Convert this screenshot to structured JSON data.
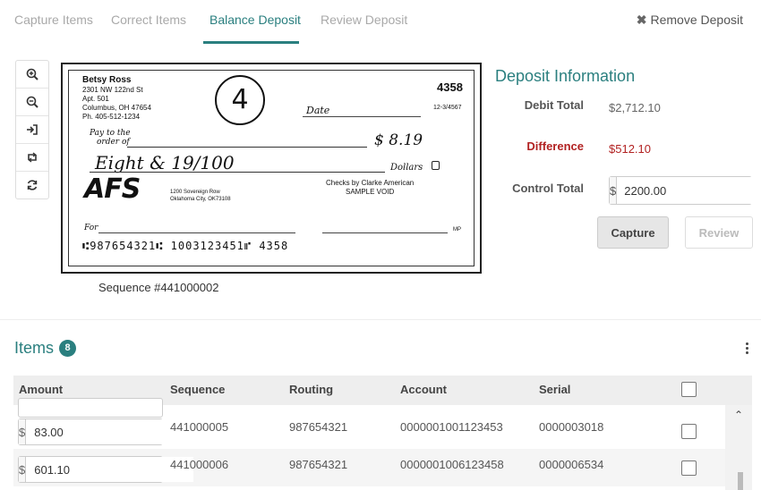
{
  "tabs": [
    {
      "label": "Capture Items"
    },
    {
      "label": "Correct Items"
    },
    {
      "label": "Balance Deposit"
    },
    {
      "label": "Review Deposit"
    }
  ],
  "remove_deposit": "Remove Deposit",
  "tools": [
    "zoom-in-icon",
    "zoom-out-icon",
    "sign-in-icon",
    "retweet-icon",
    "refresh-icon"
  ],
  "check": {
    "name": "Betsy Ross",
    "address1": "2301 NW 122nd St",
    "address2": "Apt. 501",
    "address3": "Columbus, OH 47654",
    "phone": "Ph. 405-512-1234",
    "number": "4358",
    "routing_frac": "12-3/4567",
    "date_label": "Date",
    "pay_to": "Pay to the",
    "order_of": "order of",
    "amount_box": "$ 8.19",
    "written": "Eight & 19/100",
    "dollars": "Dollars",
    "circled": "4",
    "bank1": "Checks by Clarke American",
    "bank2": "SAMPLE VOID",
    "logo": "AFS",
    "bank_addr1": "1200 Sovereign Row",
    "bank_addr2": "Oklahoma City, OK73108",
    "for_label": "For",
    "micr": "⑆987654321⑆  1003123451⑈  4358",
    "mp": "MP"
  },
  "sequence_caption": "Sequence #441000002",
  "deposit": {
    "title": "Deposit Information",
    "debit_label": "Debit Total",
    "debit_value": "$2,712.10",
    "diff_label": "Difference",
    "diff_value": "$512.10",
    "control_label": "Control Total",
    "control_currency": "$",
    "control_value": "2200.00",
    "capture_label": "Capture",
    "review_label": "Review"
  },
  "items": {
    "title": "Items",
    "count": "8",
    "columns": [
      "Amount",
      "Sequence",
      "Routing",
      "Account",
      "Serial"
    ],
    "rows": [
      {
        "currency": "$",
        "amount": "83.00",
        "sequence": "441000005",
        "routing": "987654321",
        "account": "0000001001123453",
        "serial": "0000003018"
      },
      {
        "currency": "$",
        "amount": "601.10",
        "sequence": "441000006",
        "routing": "987654321",
        "account": "0000001006123458",
        "serial": "0000006534"
      }
    ]
  },
  "colors": {
    "accent": "#2a7f7f",
    "danger": "#b22222"
  }
}
